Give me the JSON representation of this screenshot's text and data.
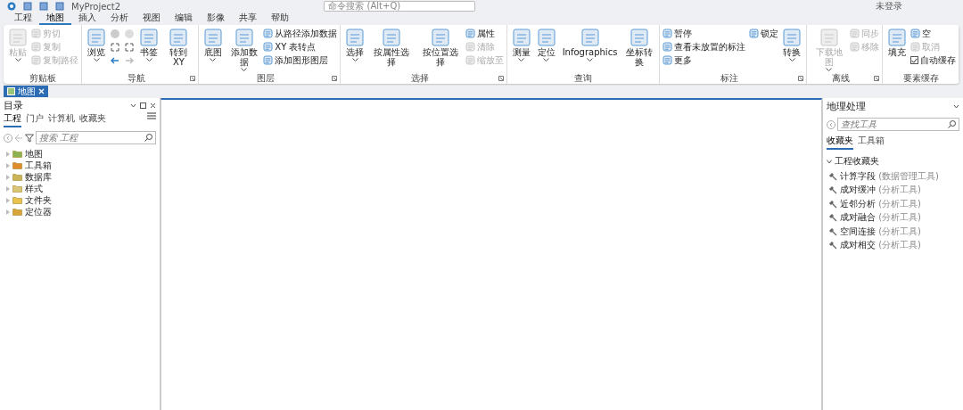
{
  "quickbar": {
    "title": "MyProject2",
    "search_placeholder": "命令搜索 (Alt+Q)",
    "user": "未登录"
  },
  "tabs": [
    {
      "label": "工程",
      "selected": false
    },
    {
      "label": "地图",
      "selected": true
    },
    {
      "label": "插入",
      "selected": false
    },
    {
      "label": "分析",
      "selected": false
    },
    {
      "label": "视图",
      "selected": false
    },
    {
      "label": "编辑",
      "selected": false
    },
    {
      "label": "影像",
      "selected": false
    },
    {
      "label": "共享",
      "selected": false
    },
    {
      "label": "帮助",
      "selected": false
    }
  ],
  "ribbon_groups": [
    {
      "label": "剪贴板",
      "launcher": false,
      "items": [
        {
          "kind": "large",
          "label": "粘贴",
          "disabled": true,
          "dropdown": true
        },
        {
          "kind": "small",
          "label": "剪切",
          "disabled": true
        },
        {
          "kind": "small",
          "label": "复制",
          "disabled": true
        },
        {
          "kind": "small",
          "label": "复制路径",
          "disabled": true
        }
      ]
    },
    {
      "label": "导航",
      "launcher": true,
      "items": [
        {
          "kind": "large",
          "label": "浏览",
          "disabled": false,
          "dropdown": true
        },
        {
          "kind": "nav"
        },
        {
          "kind": "large",
          "label": "书签",
          "disabled": false,
          "dropdown": true
        },
        {
          "kind": "large",
          "label": "转到 XY",
          "disabled": false,
          "dropdown": false
        }
      ]
    },
    {
      "label": "图层",
      "launcher": true,
      "items": [
        {
          "kind": "large",
          "label": "底图",
          "disabled": false,
          "dropdown": true
        },
        {
          "kind": "large",
          "label": "添加数据",
          "disabled": false,
          "dropdown": true
        },
        {
          "kind": "small",
          "label": "从路径添加数据",
          "disabled": false
        },
        {
          "kind": "small",
          "label": "XY 表转点",
          "disabled": false
        },
        {
          "kind": "small",
          "label": "添加图形图层",
          "disabled": false
        }
      ]
    },
    {
      "label": "选择",
      "launcher": true,
      "items": [
        {
          "kind": "large",
          "label": "选择",
          "disabled": false,
          "dropdown": true
        },
        {
          "kind": "large",
          "label": "按属性选择",
          "disabled": false,
          "dropdown": false
        },
        {
          "kind": "large",
          "label": "按位置选择",
          "disabled": false,
          "dropdown": false
        },
        {
          "kind": "small",
          "label": "属性",
          "disabled": false
        },
        {
          "kind": "small",
          "label": "清除",
          "disabled": true
        },
        {
          "kind": "small",
          "label": "缩放至",
          "disabled": true
        }
      ]
    },
    {
      "label": "查询",
      "launcher": false,
      "items": [
        {
          "kind": "large",
          "label": "测量",
          "disabled": false,
          "dropdown": true
        },
        {
          "kind": "large",
          "label": "定位",
          "disabled": false,
          "dropdown": true
        },
        {
          "kind": "large",
          "label": "Infographics",
          "disabled": false,
          "dropdown": true
        },
        {
          "kind": "large",
          "label": "坐标转换",
          "disabled": false,
          "dropdown": false
        }
      ]
    },
    {
      "label": "标注",
      "launcher": true,
      "items": [
        {
          "kind": "small",
          "label": "暂停",
          "disabled": false
        },
        {
          "kind": "small",
          "label": "查看未放置的标注",
          "disabled": false
        },
        {
          "kind": "small",
          "label": "更多",
          "disabled": false
        },
        {
          "kind": "small",
          "label": "锁定",
          "disabled": false
        },
        {
          "kind": "large",
          "label": "转换",
          "disabled": false,
          "dropdown": true
        }
      ]
    },
    {
      "label": "离线",
      "launcher": true,
      "items": [
        {
          "kind": "large",
          "label": "下载地图",
          "disabled": true,
          "dropdown": true
        },
        {
          "kind": "small",
          "label": "同步",
          "disabled": true
        },
        {
          "kind": "small",
          "label": "移除",
          "disabled": true
        }
      ]
    },
    {
      "label": "要素缓存",
      "launcher": false,
      "items": [
        {
          "kind": "large",
          "label": "填充",
          "disabled": false,
          "dropdown": false
        },
        {
          "kind": "small",
          "label": "空",
          "disabled": false
        },
        {
          "kind": "small",
          "label": "取消",
          "disabled": true
        },
        {
          "kind": "check",
          "label": "自动缓存",
          "checked": true
        }
      ]
    }
  ],
  "map_tab": {
    "label": "地图",
    "selected": true
  },
  "catalog": {
    "title": "目录",
    "tabs": [
      {
        "label": "工程",
        "selected": true
      },
      {
        "label": "门户",
        "selected": false
      },
      {
        "label": "计算机",
        "selected": false
      },
      {
        "label": "收藏夹",
        "selected": false
      }
    ],
    "search_placeholder": "搜索 工程",
    "items": [
      {
        "label": "地图",
        "expanded": false
      },
      {
        "label": "工具箱",
        "expanded": false
      },
      {
        "label": "数据库",
        "expanded": false
      },
      {
        "label": "样式",
        "expanded": false
      },
      {
        "label": "文件夹",
        "expanded": false
      },
      {
        "label": "定位器",
        "expanded": false
      }
    ]
  },
  "geoprocessing": {
    "title": "地理处理",
    "search_placeholder": "查找工具",
    "tabs": [
      {
        "label": "收藏夹",
        "selected": true
      },
      {
        "label": "工具箱",
        "selected": false
      }
    ],
    "section": {
      "label": "工程收藏夹",
      "expanded": true,
      "tools": [
        {
          "name": "计算字段",
          "toolbox": "(数据管理工具)"
        },
        {
          "name": "成对缓冲",
          "toolbox": "(分析工具)"
        },
        {
          "name": "近邻分析",
          "toolbox": "(分析工具)"
        },
        {
          "name": "成对融合",
          "toolbox": "(分析工具)"
        },
        {
          "name": "空间连接",
          "toolbox": "(分析工具)"
        },
        {
          "name": "成对相交",
          "toolbox": "(分析工具)"
        }
      ]
    }
  }
}
